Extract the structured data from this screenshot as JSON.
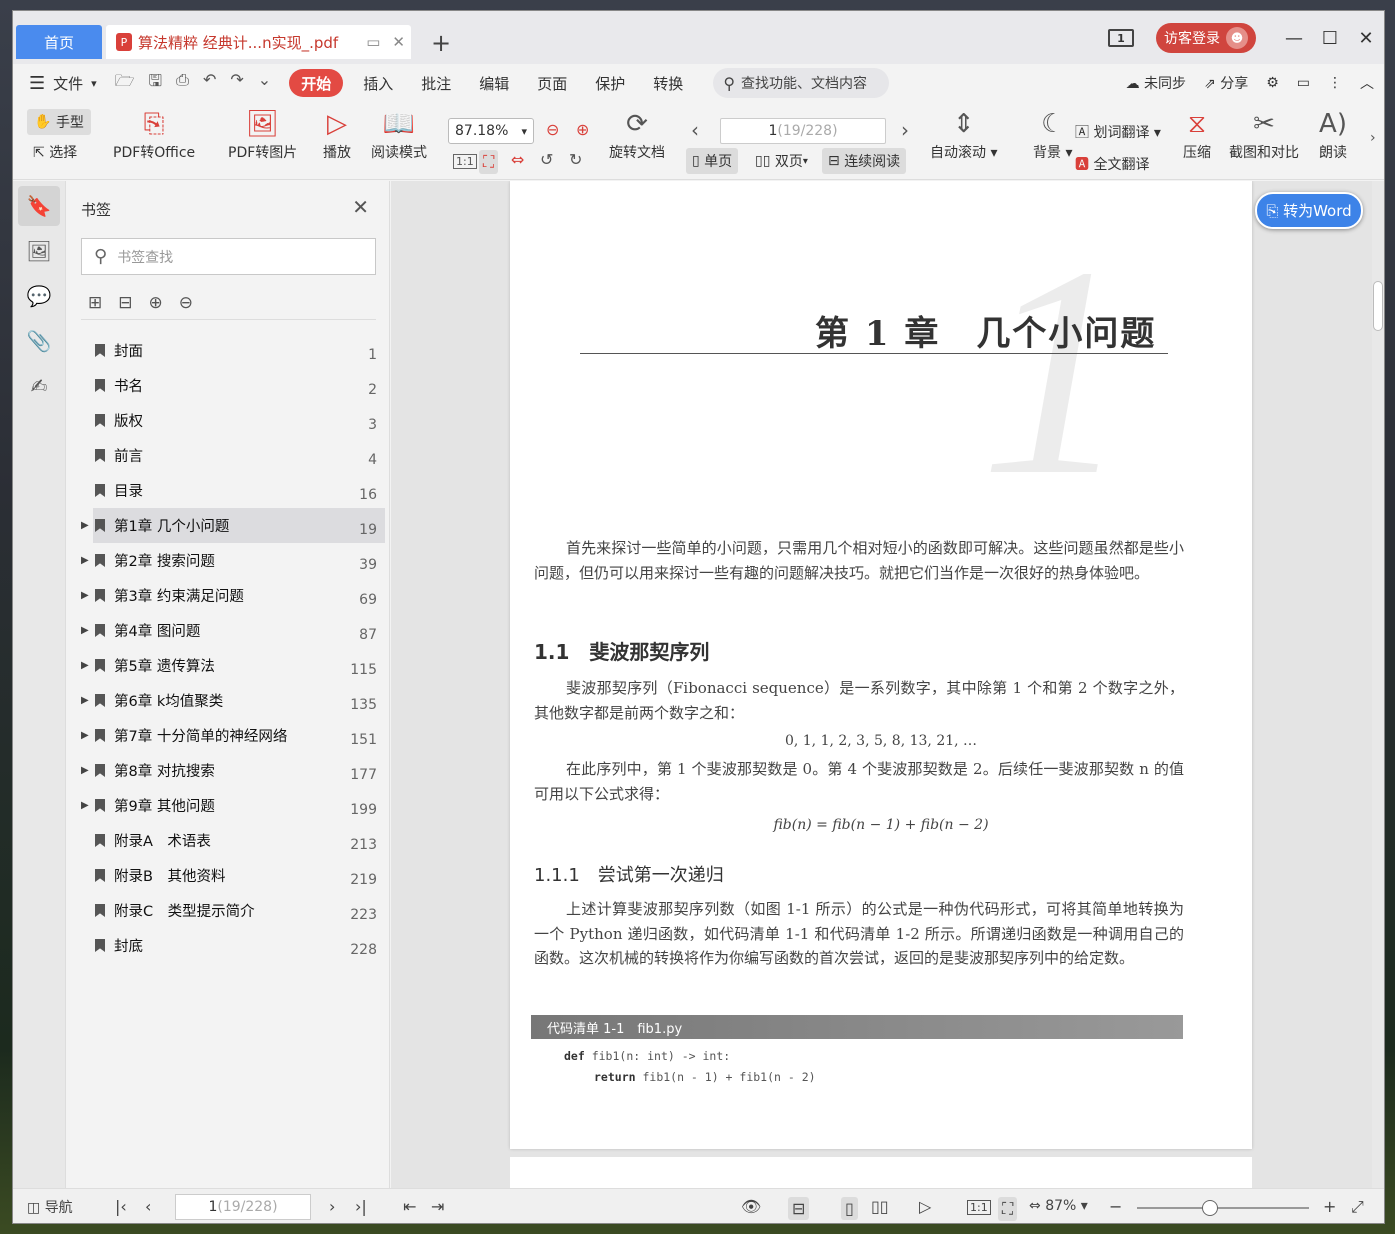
{
  "titlebar": {
    "home_tab": "首页",
    "doc_tab": "算法精粹 经典计...n实现_.pdf",
    "pdf_badge": "P",
    "page_indicator": "1",
    "login_label": "访客登录",
    "avatar_glyph": "☻"
  },
  "menu": {
    "file_label": "文件",
    "tabs": [
      "开始",
      "插入",
      "批注",
      "编辑",
      "页面",
      "保护",
      "转换"
    ],
    "search_label": "查找功能、文档内容",
    "sync_label": "未同步",
    "share_label": "分享"
  },
  "ribbon": {
    "hand_label": "手型",
    "select_label": "选择",
    "pdf_to_office": "PDF转Office",
    "pdf_to_image": "PDF转图片",
    "play": "播放",
    "read_mode": "阅读模式",
    "zoom_value": "87.18%",
    "page_current": "1",
    "page_total": " (19/228)",
    "rotate_doc": "旋转文档",
    "single_page": "单页",
    "double_page": "双页",
    "continuous": "连续阅读",
    "auto_scroll": "自动滚动",
    "background": "背景",
    "word_translate": "划词翻译",
    "full_translate": "全文翻译",
    "compress": "压缩",
    "screenshot_compare": "截图和对比",
    "read_aloud": "朗读",
    "fit_label": "1:1"
  },
  "bookmarks": {
    "title": "书签",
    "search_placeholder": "书签查找",
    "items": [
      {
        "label": "封面",
        "page": "1",
        "expandable": false
      },
      {
        "label": "书名",
        "page": "2",
        "expandable": false
      },
      {
        "label": "版权",
        "page": "3",
        "expandable": false
      },
      {
        "label": "前言",
        "page": "4",
        "expandable": false
      },
      {
        "label": "目录",
        "page": "16",
        "expandable": false
      },
      {
        "label": "第1章 几个小问题",
        "page": "19",
        "expandable": true
      },
      {
        "label": "第2章 搜索问题",
        "page": "39",
        "expandable": true
      },
      {
        "label": "第3章 约束满足问题",
        "page": "69",
        "expandable": true
      },
      {
        "label": "第4章 图问题",
        "page": "87",
        "expandable": true
      },
      {
        "label": "第5章 遗传算法",
        "page": "115",
        "expandable": true
      },
      {
        "label": "第6章 k均值聚类",
        "page": "135",
        "expandable": true
      },
      {
        "label": "第7章 十分简单的神经网络",
        "page": "151",
        "expandable": true
      },
      {
        "label": "第8章 对抗搜索",
        "page": "177",
        "expandable": true
      },
      {
        "label": "第9章 其他问题",
        "page": "199",
        "expandable": true
      },
      {
        "label": "附录A　术语表",
        "page": "213",
        "expandable": false
      },
      {
        "label": "附录B　其他资料",
        "page": "219",
        "expandable": false
      },
      {
        "label": "附录C　类型提示简介",
        "page": "223",
        "expandable": false
      },
      {
        "label": "封底",
        "page": "228",
        "expandable": false
      }
    ]
  },
  "document": {
    "chapter_number": "1",
    "chapter_title": "第 1 章　几个小问题",
    "intro": "首先来探讨一些简单的小问题，只需用几个相对短小的函数即可解决。这些问题虽然都是些小问题，但仍可以用来探讨一些有趣的问题解决技巧。就把它们当作是一次很好的热身体验吧。",
    "sec_1_1": "1.1　斐波那契序列",
    "para_fib": "斐波那契序列（Fibonacci sequence）是一系列数字，其中除第 1 个和第 2 个数字之外，其他数字都是前两个数字之和：",
    "sequence": "0, 1, 1, 2, 3, 5, 8, 13, 21, …",
    "para_fib2": "在此序列中，第 1 个斐波那契数是 0。第 4 个斐波那契数是 2。后续任一斐波那契数 n 的值可用以下公式求得：",
    "formula": "fib(n) = fib(n − 1) + fib(n − 2)",
    "sec_1_1_1": "1.1.1　尝试第一次递归",
    "para_rec": "上述计算斐波那契序列数（如图 1-1 所示）的公式是一种伪代码形式，可将其简单地转换为一个 Python 递归函数，如代码清单 1-1 和代码清单 1-2 所示。所谓递归函数是一种调用自己的函数。这次机械的转换将作为你编写函数的首次尝试，返回的是斐波那契序列中的给定数。",
    "code_caption": "代码清单 1-1　fib1.py",
    "code_kw1": "def",
    "code_line1": " fib1(n: int) -> int:",
    "code_kw2": "return",
    "code_line2": " fib1(n - 1) + fib1(n - 2)"
  },
  "to_word": "转为Word",
  "statusbar": {
    "nav_label": "导航",
    "page_current": "1",
    "page_total": " (19/228)",
    "zoom_value": "87%",
    "fit_label": "1:1"
  }
}
